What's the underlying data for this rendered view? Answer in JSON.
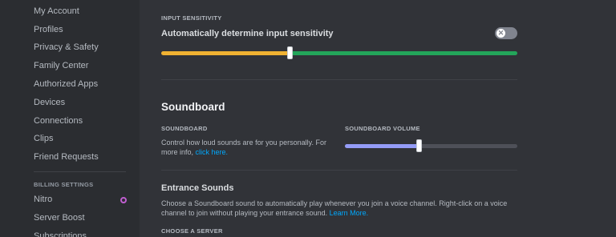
{
  "sidebar": {
    "items": [
      {
        "label": "My Account"
      },
      {
        "label": "Profiles"
      },
      {
        "label": "Privacy & Safety"
      },
      {
        "label": "Family Center"
      },
      {
        "label": "Authorized Apps"
      },
      {
        "label": "Devices"
      },
      {
        "label": "Connections"
      },
      {
        "label": "Clips"
      },
      {
        "label": "Friend Requests"
      }
    ],
    "billing_header": "BILLING SETTINGS",
    "billing_items": [
      {
        "label": "Nitro",
        "icon": "nitro-icon"
      },
      {
        "label": "Server Boost"
      },
      {
        "label": "Subscriptions"
      }
    ]
  },
  "input_sensitivity": {
    "header": "INPUT SENSITIVITY",
    "auto_label": "Automatically determine input sensitivity",
    "toggle_on": false,
    "toggle_icon": "close-icon",
    "slider_value": 0.36,
    "colors": {
      "below": "#f0b232",
      "above": "#23a55a"
    }
  },
  "soundboard": {
    "title": "Soundboard",
    "section_label": "SOUNDBOARD",
    "desc_text": "Control how loud sounds are for you personally. For more info,",
    "desc_link": "click here.",
    "volume_label": "SOUNDBOARD VOLUME",
    "volume_value": 0.43,
    "colors": {
      "fill": "#949cf7",
      "track": "#4e5058"
    }
  },
  "entrance": {
    "title": "Entrance Sounds",
    "desc_text": "Choose a Soundboard sound to automatically play whenever you join a voice channel. Right-click on a voice channel to join without playing your entrance sound.",
    "desc_link": "Learn More.",
    "choose_label": "CHOOSE A SERVER"
  }
}
